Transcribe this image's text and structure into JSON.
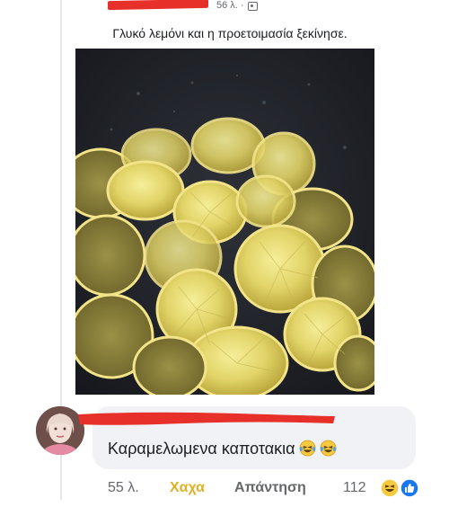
{
  "post": {
    "time": "56 λ.",
    "separator": "·",
    "photo_icon": "photo-icon",
    "caption": "Γλυκό λεμόνι και η προετοιμασία ξεκίνησε."
  },
  "photo": {
    "subject": "lemon-slices-in-pan"
  },
  "comment": {
    "text": "Καραμελωμενα καποτακια",
    "emojis": [
      "laughing-tears-emoji",
      "laughing-tears-emoji"
    ],
    "time": "55 λ.",
    "reaction_label": "Χαχα",
    "reply_label": "Απάντηση",
    "reaction_count": "112",
    "reaction_icons": [
      "haha-reaction-icon",
      "like-reaction-icon"
    ]
  },
  "colors": {
    "redaction": "#e8302a",
    "haha": "#e0b126",
    "like": "#1877f2",
    "bubble": "#f0f2f5",
    "muted": "#65676b"
  }
}
